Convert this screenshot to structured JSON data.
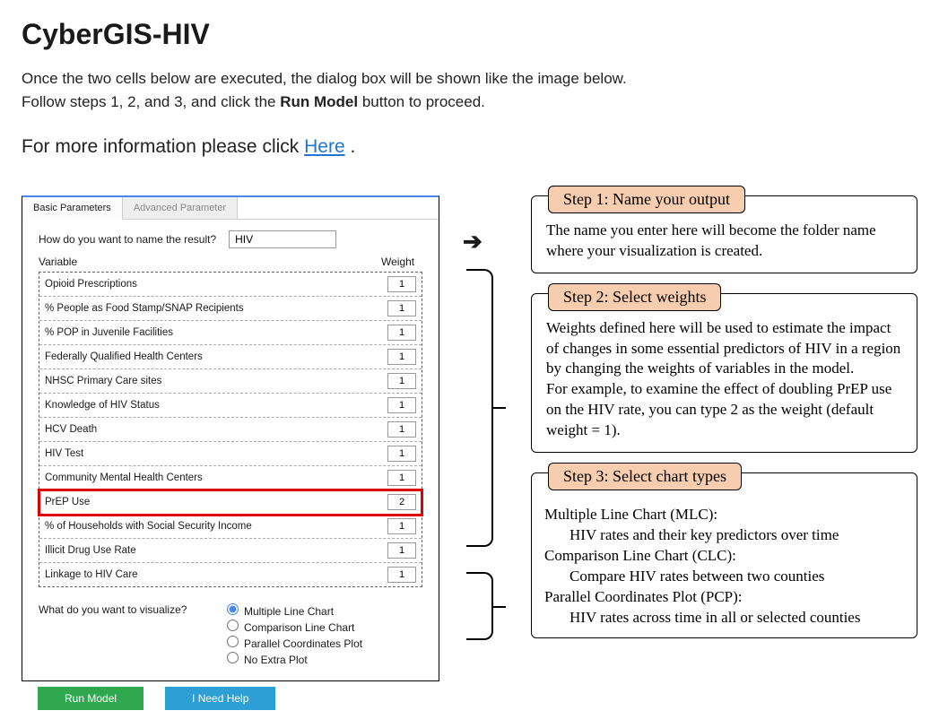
{
  "heading": "CyberGIS-HIV",
  "intro_1a": "Once the two cells below are executed, the dialog box will be shown like the image below.",
  "intro_2a": "Follow steps 1, 2, and 3, and click the ",
  "intro_2b": "Run Model",
  "intro_2c": " button to proceed.",
  "info_prefix": "For more information please click ",
  "info_link": "Here",
  "info_suffix": " .",
  "dialog": {
    "tabs": {
      "basic": "Basic Parameters",
      "advanced": "Advanced Parameter"
    },
    "name_q": "How do you want to name the result?",
    "name_val": "HIV",
    "header_var": "Variable",
    "header_wt": "Weight",
    "vars": [
      {
        "label": "Opioid Prescriptions",
        "w": "1"
      },
      {
        "label": "% People as Food Stamp/SNAP Recipients",
        "w": "1"
      },
      {
        "label": "% POP in Juvenile Facilities",
        "w": "1"
      },
      {
        "label": "Federally Qualified Health Centers",
        "w": "1"
      },
      {
        "label": "NHSC Primary Care sites",
        "w": "1"
      },
      {
        "label": "Knowledge of HIV Status",
        "w": "1"
      },
      {
        "label": "HCV Death",
        "w": "1"
      },
      {
        "label": "HIV Test",
        "w": "1"
      },
      {
        "label": "Community Mental Health Centers",
        "w": "1"
      },
      {
        "label": "PrEP Use",
        "w": "2"
      },
      {
        "label": "% of Households with Social Security Income",
        "w": "1"
      },
      {
        "label": "Illicit Drug Use Rate",
        "w": "1"
      },
      {
        "label": "Linkage to HIV Care",
        "w": "1"
      }
    ],
    "vis_q": "What do you want to visualize?",
    "vis_opts": [
      "Multiple Line Chart",
      "Comparison Line Chart",
      "Parallel Coordinates Plot",
      "No Extra Plot"
    ],
    "run_label": "Run Model",
    "help_label": "I Need Help"
  },
  "steps": {
    "s1_title": "Step 1: Name your output",
    "s1_body": "The name you enter here will become the folder name where your visualization is created.",
    "s2_title": "Step 2: Select weights",
    "s2_body_a": "Weights defined here will be used to estimate the impact of changes in some essential predictors of HIV in a region by changing the weights of variables in the model.",
    "s2_body_b": "For example, to examine the effect of doubling PrEP use on the HIV rate, you can type 2 as the weight (default weight = 1).",
    "s3_title": "Step 3: Select chart types",
    "s3_l1": "Multiple Line Chart (MLC):",
    "s3_l1s": "HIV rates and their key predictors over time",
    "s3_l2": "Comparison Line Chart (CLC):",
    "s3_l2s": "Compare HIV rates between two counties",
    "s3_l3": "Parallel Coordinates Plot (PCP):",
    "s3_l3s": "HIV rates across time in all or selected counties"
  }
}
